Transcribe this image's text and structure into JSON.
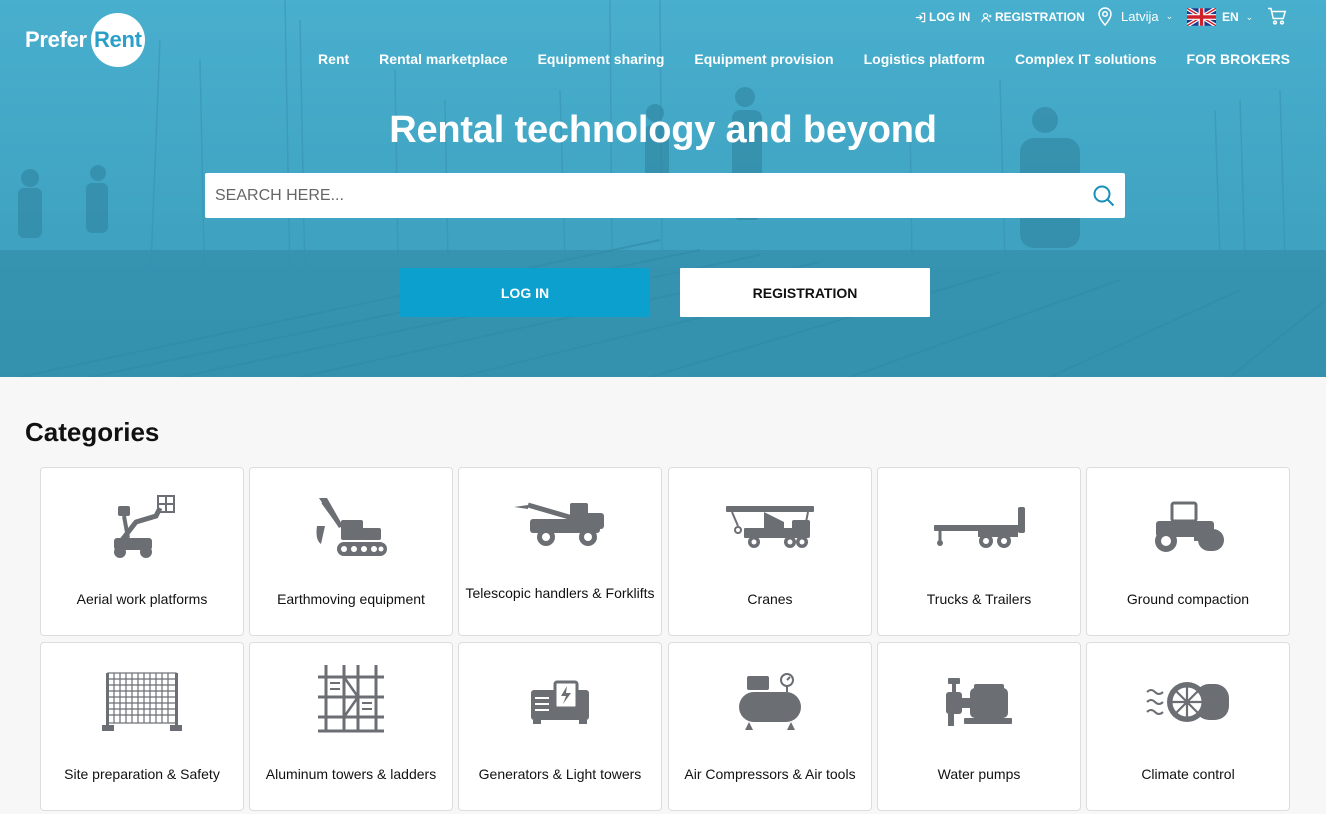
{
  "brand": {
    "prefer": "Prefer",
    "rent": "Rent"
  },
  "topbar": {
    "login": "LOG IN",
    "registration": "REGISTRATION",
    "country": "Latvija",
    "language": "EN"
  },
  "nav": [
    {
      "label": "Rent"
    },
    {
      "label": "Rental marketplace"
    },
    {
      "label": "Equipment sharing"
    },
    {
      "label": "Equipment provision"
    },
    {
      "label": "Logistics platform"
    },
    {
      "label": "Complex IT solutions"
    },
    {
      "label": "FOR BROKERS"
    }
  ],
  "hero": {
    "title": "Rental technology and beyond",
    "search_placeholder": "SEARCH HERE...",
    "login_button": "LOG IN",
    "registration_button": "REGISTRATION"
  },
  "categories": {
    "title": "Categories",
    "items": [
      {
        "label": "Aerial work platforms",
        "icon": "aerial-platform-icon"
      },
      {
        "label": "Earthmoving equipment",
        "icon": "excavator-icon"
      },
      {
        "label": "Telescopic handlers & Forklifts",
        "icon": "telehandler-icon"
      },
      {
        "label": "Cranes",
        "icon": "crane-truck-icon"
      },
      {
        "label": "Trucks & Trailers",
        "icon": "trailer-icon"
      },
      {
        "label": "Ground compaction",
        "icon": "roller-icon"
      },
      {
        "label": "Site preparation & Safety",
        "icon": "fence-icon"
      },
      {
        "label": "Aluminum towers & ladders",
        "icon": "scaffold-icon"
      },
      {
        "label": "Generators & Light towers",
        "icon": "generator-icon"
      },
      {
        "label": "Air Compressors & Air tools",
        "icon": "compressor-icon"
      },
      {
        "label": "Water pumps",
        "icon": "water-pump-icon"
      },
      {
        "label": "Climate control",
        "icon": "heater-icon"
      }
    ]
  },
  "colors": {
    "accent": "#0ca0cf",
    "icon_gray": "#6b6e73",
    "hero_tint": "#4aa9c6"
  }
}
